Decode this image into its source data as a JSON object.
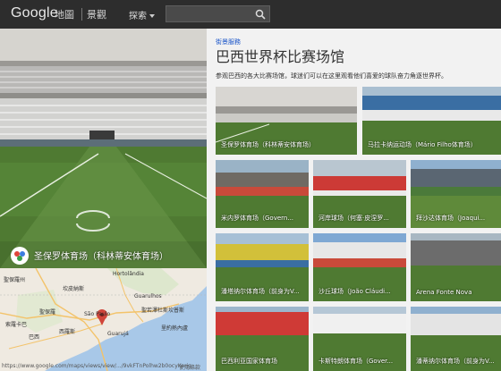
{
  "header": {
    "logo_text": "Google",
    "logo_sub": "地圖",
    "logo_sub2": "景觀",
    "search_menu_label": "探索",
    "search_placeholder": ""
  },
  "panorama": {
    "caption": "圣保罗体育场（科林蒂安体育场）"
  },
  "map": {
    "url_text": "https://www.google.com/maps/views/view/.../9vkFTnPolhw2b0ocyKorjg",
    "terms_text": "使用條款",
    "labels": [
      "Hortolândia",
      "聖保羅州",
      "坎皮納斯",
      "Guarulhos",
      "聖若澤杜斯坎普斯",
      "São Paulo",
      "聖保羅",
      "索羅卡巴",
      "巴西",
      "西羅斯",
      "Guarujá",
      "里約熱內盧"
    ]
  },
  "gallery": {
    "breadcrumb": "街景服務",
    "title": "巴西世界杯比赛场馆",
    "description": "参观巴西的各大比赛场馆，球迷们可以在这里观看他们喜爱的球队奋力角逐世界杯。",
    "cards": [
      {
        "label": "圣保罗体育场（科林蒂安体育场）",
        "selected": true
      },
      {
        "label": "马拉卡纳运动场（Mário Filho体育场）",
        "selected": false
      },
      {
        "label": "米内罗体育场（Govern...",
        "selected": false
      },
      {
        "label": "河岸球场（何塞·皮涅罗...",
        "selected": false
      },
      {
        "label": "拜沙达体育场（Joaqui...",
        "selected": false
      },
      {
        "label": "潘塔纳尔体育场（前身为V...",
        "selected": false
      },
      {
        "label": "沙丘球场（João Cláudi...",
        "selected": false
      },
      {
        "label": "Arena Fonte Nova",
        "selected": false
      },
      {
        "label": "巴西利亚国家体育场",
        "selected": false
      },
      {
        "label": "卡斯特朗体育场（Gover...",
        "selected": false
      },
      {
        "label": "潘蒂纳尔体育场（前身为V...",
        "selected": false
      }
    ]
  },
  "colors": {
    "topbar": "#2d2d2d",
    "accent": "#1a55c9",
    "selected_outline": "#5a8be0",
    "pitch_green": "#4f7a32"
  }
}
